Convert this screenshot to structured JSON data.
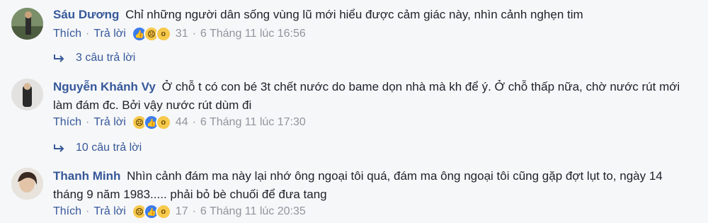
{
  "comments": [
    {
      "author": "Sáu Dương",
      "text": "Chỉ những người dân sống vùng lũ mới hiểu được cảm giác này, nhìn cảnh nghẹn tim",
      "like_label": "Thích",
      "reply_label": "Trả lời",
      "reactions": [
        "like",
        "sad",
        "wow"
      ],
      "reaction_count": "31",
      "timestamp": "6 Tháng 11 lúc 16:56",
      "replies_label": "3 câu trả lời"
    },
    {
      "author": "Nguyễn Khánh Vy",
      "text": "Ở chỗ t có con bé 3t chết nước do bame dọn nhà mà kh để ý. Ở chỗ thấp nữa, chờ nước rút mới làm đám đc. Bởi vậy nước rút dùm đi",
      "like_label": "Thích",
      "reply_label": "Trả lời",
      "reactions": [
        "sad",
        "like",
        "wow"
      ],
      "reaction_count": "44",
      "timestamp": "6 Tháng 11 lúc 17:30",
      "replies_label": "10 câu trả lời"
    },
    {
      "author": "Thanh Minh",
      "text": "Nhìn cảnh đám ma này lại nhớ ông ngoại tôi quá, đám ma ông ngoại tôi cũng gặp đợt lụt to, ngày 14 tháng 9 năm 1983..... phải bỏ bè chuối để đưa tang",
      "like_label": "Thích",
      "reply_label": "Trả lời",
      "reactions": [
        "sad",
        "like",
        "wow"
      ],
      "reaction_count": "17",
      "timestamp": "6 Tháng 11 lúc 20:35"
    }
  ],
  "separator": "·",
  "colors": {
    "link": "#365899",
    "meta": "#90949c",
    "background": "#f6f7f9"
  },
  "icons": {
    "like": "like-reaction-icon",
    "sad": "sad-reaction-icon",
    "wow": "wow-reaction-icon",
    "reply": "reply-arrow-icon"
  }
}
